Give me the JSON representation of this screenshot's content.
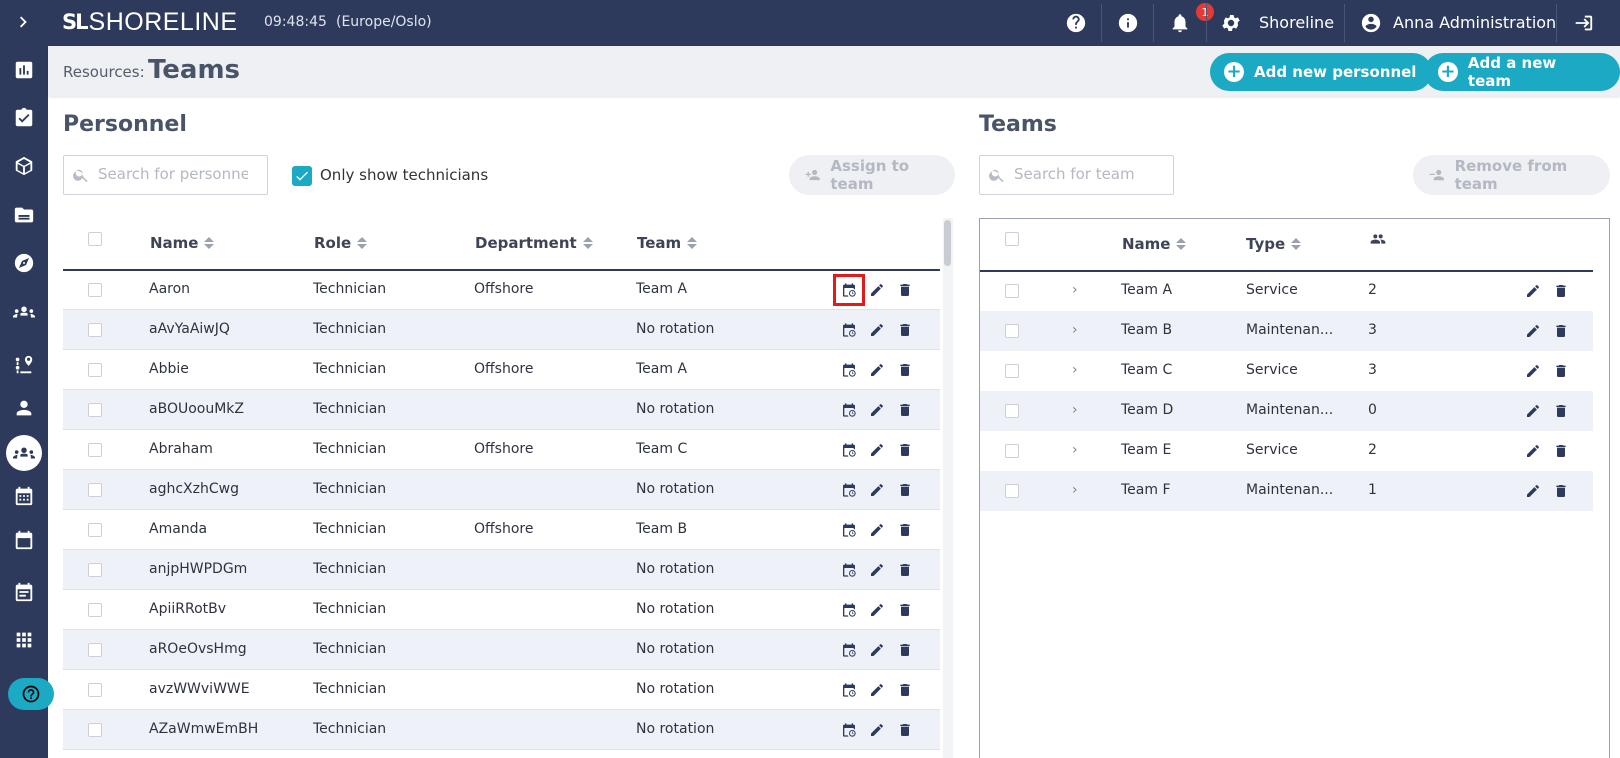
{
  "app": {
    "brand_mark": "SL",
    "brand_name": "SHORELINE",
    "time": "09:48:45",
    "timezone": "(Europe/Oslo)",
    "notification_count": "1",
    "org_name": "Shoreline",
    "user_name": "Anna Administration"
  },
  "sidebar": {
    "items": [
      {
        "icon": "chevron-right-icon"
      },
      {
        "icon": "dashboard-chart-icon"
      },
      {
        "icon": "clipboard-check-icon"
      },
      {
        "icon": "cube-icon"
      },
      {
        "icon": "folder-icon"
      },
      {
        "icon": "compass-icon"
      },
      {
        "icon": "people-icon"
      },
      {
        "icon": "route-pin-icon"
      },
      {
        "icon": "person-icon"
      },
      {
        "icon": "teams-icon",
        "active": true
      },
      {
        "icon": "calendar-grid-icon"
      },
      {
        "icon": "calendar-icon"
      },
      {
        "icon": "list-calendar-icon"
      },
      {
        "icon": "apps-grid-icon"
      }
    ],
    "help_icon": "help-icon"
  },
  "page": {
    "breadcrumb": "Resources:",
    "title": "Teams",
    "add_personnel_label": "Add new personnel",
    "add_team_label": "Add a new team"
  },
  "personnel": {
    "title": "Personnel",
    "search_placeholder": "Search for personnel",
    "only_technicians_label": "Only show technicians",
    "only_technicians_checked": true,
    "assign_label": "Assign to team",
    "columns": [
      "Name",
      "Role",
      "Department",
      "Team"
    ],
    "rows": [
      {
        "name": "Aaron",
        "role": "Technician",
        "department": "Offshore",
        "team": "Team A"
      },
      {
        "name": "aAvYaAiwJQ",
        "role": "Technician",
        "department": "",
        "team": "No rotation"
      },
      {
        "name": "Abbie",
        "role": "Technician",
        "department": "Offshore",
        "team": "Team A"
      },
      {
        "name": "aBOUoouMkZ",
        "role": "Technician",
        "department": "",
        "team": "No rotation"
      },
      {
        "name": "Abraham",
        "role": "Technician",
        "department": "Offshore",
        "team": "Team C"
      },
      {
        "name": "aghcXzhCwg",
        "role": "Technician",
        "department": "",
        "team": "No rotation"
      },
      {
        "name": "Amanda",
        "role": "Technician",
        "department": "Offshore",
        "team": "Team B"
      },
      {
        "name": "anjpHWPDGm",
        "role": "Technician",
        "department": "",
        "team": "No rotation"
      },
      {
        "name": "ApiiRRotBv",
        "role": "Technician",
        "department": "",
        "team": "No rotation"
      },
      {
        "name": "aROeOvsHmg",
        "role": "Technician",
        "department": "",
        "team": "No rotation"
      },
      {
        "name": "avzWWviWWE",
        "role": "Technician",
        "department": "",
        "team": "No rotation"
      },
      {
        "name": "AZaWmwEmBH",
        "role": "Technician",
        "department": "",
        "team": "No rotation"
      }
    ]
  },
  "teams": {
    "title": "Teams",
    "search_placeholder": "Search for team",
    "remove_label": "Remove from team",
    "columns": [
      "Name",
      "Type"
    ],
    "members_icon": "members-icon",
    "rows": [
      {
        "name": "Team A",
        "type": "Service",
        "count": "2"
      },
      {
        "name": "Team B",
        "type": "Maintenan...",
        "count": "3"
      },
      {
        "name": "Team C",
        "type": "Service",
        "count": "3"
      },
      {
        "name": "Team D",
        "type": "Maintenan...",
        "count": "0"
      },
      {
        "name": "Team E",
        "type": "Service",
        "count": "2"
      },
      {
        "name": "Team F",
        "type": "Maintenan...",
        "count": "1"
      }
    ]
  },
  "colors": {
    "navy": "#2d3a5c",
    "accent": "#1ba9c4",
    "highlight": "#e31a1a"
  }
}
